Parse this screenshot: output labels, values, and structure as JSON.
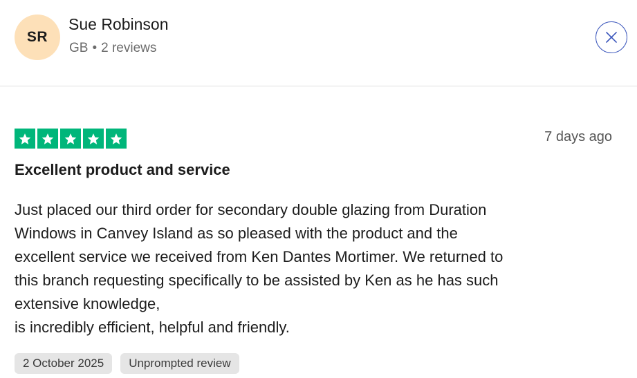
{
  "reviewer": {
    "initials": "SR",
    "name": "Sue Robinson",
    "country": "GB",
    "separator": "•",
    "reviews_count": "2 reviews"
  },
  "close": {
    "icon": "close-icon",
    "accent": "#3c57bc"
  },
  "review": {
    "rating": 5,
    "rating_max": 5,
    "star_color": "#00b67a",
    "posted": "7 days ago",
    "title": "Excellent product and service",
    "body_lines": [
      "Just placed our third order for secondary double glazing from Duration",
      "Windows in Canvey Island as so pleased with the product and the",
      "excellent service we received from Ken Dantes Mortimer. We returned to",
      "this branch requesting specifically to be assisted by Ken as he has such",
      "extensive knowledge,",
      "is incredibly efficient, helpful and friendly."
    ],
    "tags": [
      "2 October 2025",
      "Unprompted review"
    ]
  }
}
